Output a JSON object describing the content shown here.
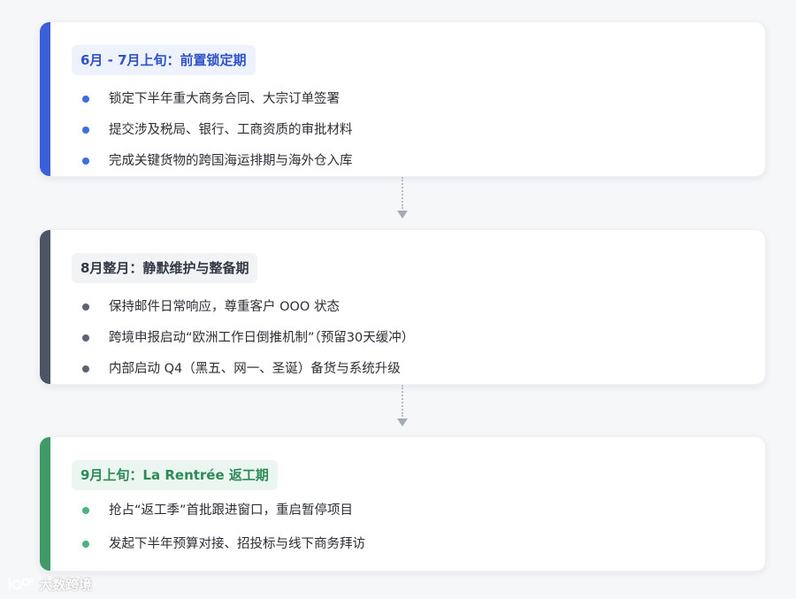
{
  "stages": [
    {
      "title": "6月 - 7月上旬：前置锁定期",
      "items": [
        "锁定下半年重大商务合同、大宗订单签署",
        "提交涉及税局、银行、工商资质的审批材料",
        "完成关键货物的跨国海运排期与海外仓入库"
      ]
    },
    {
      "title": "8月整月：静默维护与整备期",
      "items": [
        "保持邮件日常响应，尊重客户 OOO 状态",
        "跨境申报启动“欧洲工作日倒推机制”（预留30天缓冲）",
        "内部启动 Q4（黑五、网一、圣诞）备货与系统升级"
      ]
    },
    {
      "title": "9月上旬：La Rentrée 返工期",
      "items": [
        "抢占“返工季”首批跟进窗口，重启暂停项目",
        "发起下半年预算对接、招投标与线下商务拜访"
      ]
    }
  ],
  "watermark": {
    "text": "大数跨境",
    "icon": "logo-icon"
  },
  "colors": {
    "stage1_accent": "#3b5fd9",
    "stage2_accent": "#4b5563",
    "stage3_accent": "#3f9a68"
  }
}
